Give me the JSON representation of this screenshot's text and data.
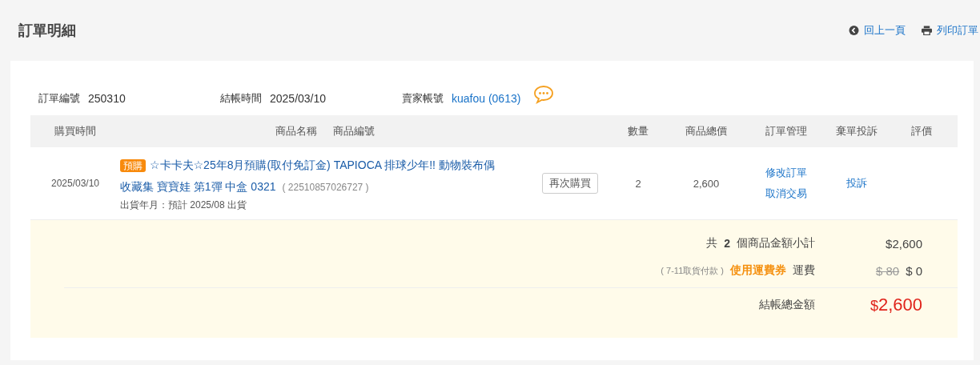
{
  "page": {
    "title": "訂單明細",
    "actions": [
      {
        "kind": "back",
        "label": "回上一頁"
      },
      {
        "kind": "print",
        "label": "列印訂單"
      }
    ]
  },
  "order_info": [
    {
      "label": "訂單編號",
      "value": "250310",
      "kind": "text"
    },
    {
      "label": "結帳時間",
      "value": "2025/03/10",
      "kind": "text"
    },
    {
      "label": "賣家帳號",
      "value": "kuafou (0613)",
      "kind": "link"
    }
  ],
  "table": {
    "columns": [
      "購買時間",
      "商品名稱",
      "商品編號",
      "",
      "數量",
      "商品總價",
      "訂單管理",
      "棄單投訴",
      "評價"
    ],
    "rows": [
      {
        "date": "2025/03/10",
        "badge": "預購",
        "title_lines": [
          "☆卡卡夫☆25年8月預購(取付免訂金) TAPIOCA 排球少年!! 動物裝布偶",
          "收藏集 寶寶娃 第1彈 中盒 0321"
        ],
        "code": "( 22510857026727 )",
        "ship_note": "出貨年月：預計 2025/08 出貨",
        "rebuy": "再次購買",
        "quantity": "2",
        "total": "2,600",
        "manage": [
          "修改訂單",
          "取消交易"
        ],
        "complaint": "投訴"
      }
    ]
  },
  "summary": {
    "subtotal": {
      "prefix": "共",
      "count": "2",
      "suffix": "個商品金額小計",
      "amount": "$2,600"
    },
    "shipping": {
      "method": "( 7-11取貨付款 )",
      "coupon": "使用運費券",
      "label": "運費",
      "original": "$ 80",
      "amount": "$ 0"
    },
    "total": {
      "label": "結帳總金額",
      "currency": "$",
      "amount": "2,600"
    }
  }
}
